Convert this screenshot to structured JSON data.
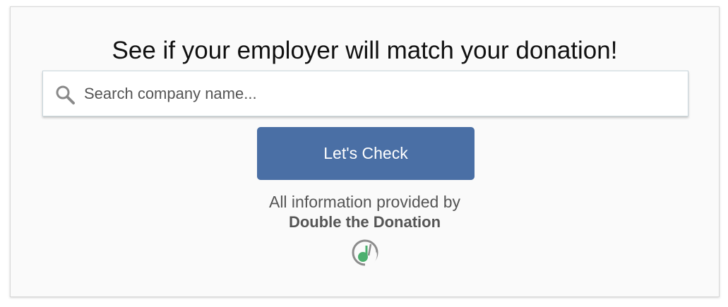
{
  "headline": "See if your employer will match your donation!",
  "search": {
    "placeholder": "Search company name...",
    "value": "",
    "icon": "search-icon"
  },
  "check_button": {
    "label": "Let's Check",
    "color": "#4a6fa5"
  },
  "credit": {
    "line": "All information provided by",
    "name": "Double the Donation",
    "logo_icon": "double-the-donation-logo"
  }
}
